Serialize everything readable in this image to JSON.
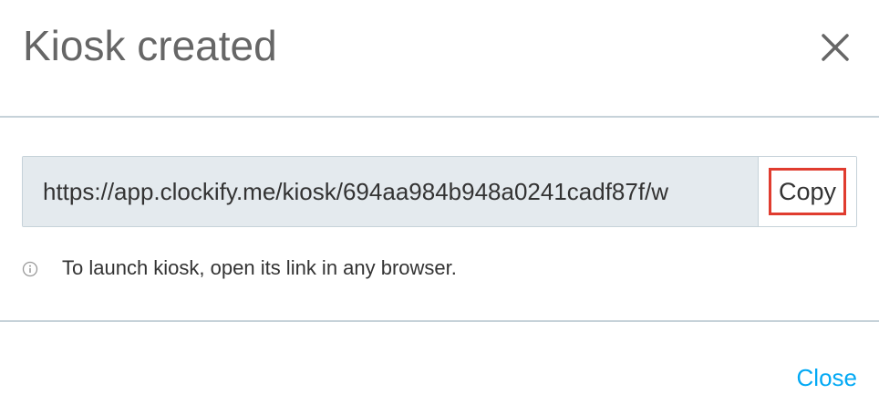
{
  "dialog": {
    "title": "Kiosk created",
    "close_icon": "close-icon"
  },
  "link": {
    "url": "https://app.clockify.me/kiosk/694aa984b948a0241cadf87f/w",
    "copy_label": "Copy",
    "copy_highlight_color": "#e03c2f"
  },
  "info": {
    "icon": "info-icon",
    "text": "To launch kiosk, open its link in any browser."
  },
  "footer": {
    "close_label": "Close"
  },
  "colors": {
    "accent": "#03a9f4",
    "input_bg": "#e4eaee",
    "border": "#c6d2d9"
  }
}
